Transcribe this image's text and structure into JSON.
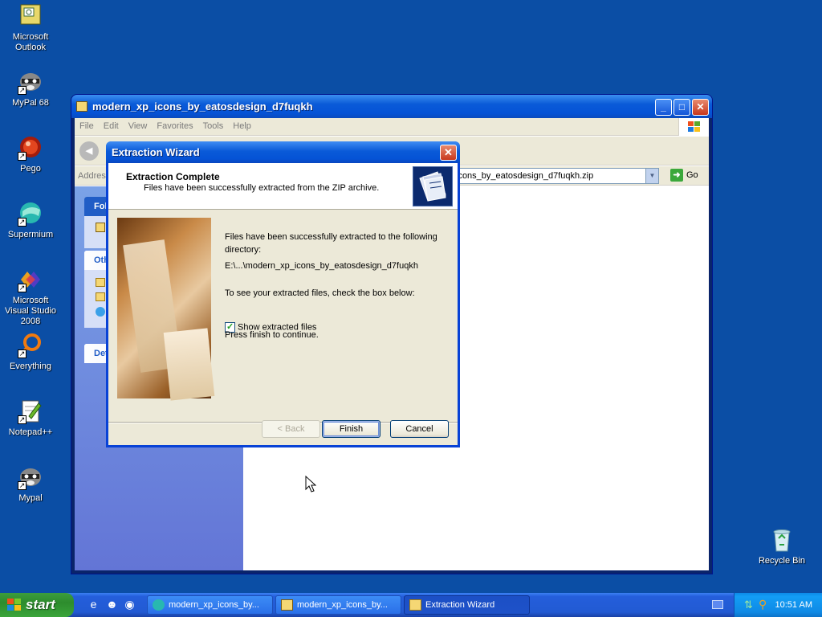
{
  "desktop": {
    "icons": [
      {
        "label": "Microsoft Outlook",
        "icon": "outlook-icon"
      },
      {
        "label": "MyPal 68",
        "icon": "raccoon-icon"
      },
      {
        "label": "Pego",
        "icon": "pego-icon"
      },
      {
        "label": "Supermium",
        "icon": "supermium-icon"
      },
      {
        "label": "Microsoft Visual Studio 2008",
        "icon": "visual-studio-icon"
      },
      {
        "label": "Everything",
        "icon": "search-icon"
      },
      {
        "label": "Notepad++",
        "icon": "notepad-icon"
      },
      {
        "label": "Mypal",
        "icon": "raccoon-icon"
      },
      {
        "label": "Recycle Bin",
        "icon": "recycle-bin-icon"
      }
    ]
  },
  "explorer": {
    "title": "modern_xp_icons_by_eatosdesign_d7fuqkh",
    "menu": [
      "File",
      "Edit",
      "View",
      "Favorites",
      "Tools",
      "Help"
    ],
    "address_label": "Addres",
    "address_value": "icons_by_eatosdesign_d7fuqkh.zip",
    "go_label": "Go",
    "left_pane": {
      "box1_head": "Fol",
      "box2_head": "Oth",
      "box3_head": "Det"
    }
  },
  "dialog": {
    "title": "Extraction Wizard",
    "header_title": "Extraction Complete",
    "header_subtitle": "Files have been successfully extracted from the ZIP archive.",
    "line1": "Files have been successfully extracted to the following",
    "line1b": "directory:",
    "path": "E:\\...\\modern_xp_icons_by_eatosdesign_d7fuqkh",
    "line2": "To see your extracted files, check the box below:",
    "checkbox_label": "Show extracted files",
    "checkbox_checked": true,
    "line3": "Press finish to continue.",
    "back_label": "< Back",
    "finish_label": "Finish",
    "cancel_label": "Cancel"
  },
  "taskbar": {
    "start_label": "start",
    "tasks": [
      {
        "label": "modern_xp_icons_by...",
        "icon": "browser-icon"
      },
      {
        "label": "modern_xp_icons_by...",
        "icon": "zip-folder-icon"
      },
      {
        "label": "Extraction Wizard",
        "icon": "folder-icon"
      }
    ],
    "clock": "10:51 AM"
  },
  "colors": {
    "desktop": "#0b4ea5",
    "titlebar": "#0553d6",
    "dialog_face": "#ece9d8",
    "start_green": "#3aa43a"
  }
}
